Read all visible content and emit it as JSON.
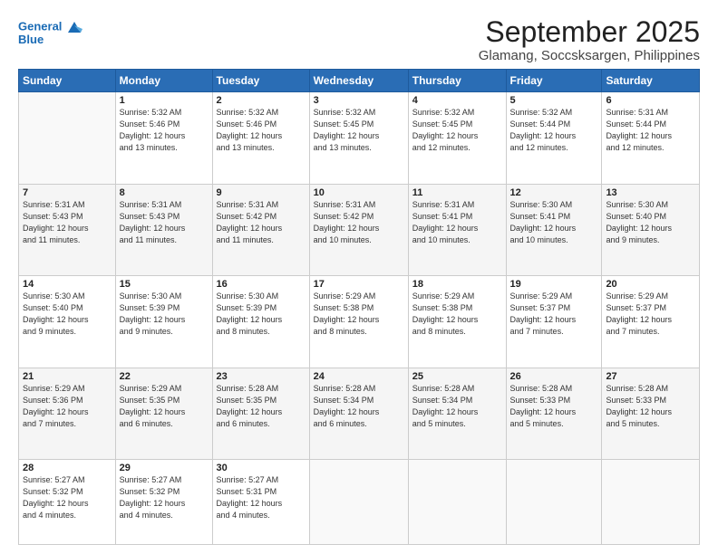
{
  "logo": {
    "line1": "General",
    "line2": "Blue",
    "alt": "GeneralBlue logo"
  },
  "title": "September 2025",
  "subtitle": "Glamang, Soccsksargen, Philippines",
  "days_header": [
    "Sunday",
    "Monday",
    "Tuesday",
    "Wednesday",
    "Thursday",
    "Friday",
    "Saturday"
  ],
  "weeks": [
    [
      {
        "num": "",
        "info": ""
      },
      {
        "num": "1",
        "info": "Sunrise: 5:32 AM\nSunset: 5:46 PM\nDaylight: 12 hours\nand 13 minutes."
      },
      {
        "num": "2",
        "info": "Sunrise: 5:32 AM\nSunset: 5:46 PM\nDaylight: 12 hours\nand 13 minutes."
      },
      {
        "num": "3",
        "info": "Sunrise: 5:32 AM\nSunset: 5:45 PM\nDaylight: 12 hours\nand 13 minutes."
      },
      {
        "num": "4",
        "info": "Sunrise: 5:32 AM\nSunset: 5:45 PM\nDaylight: 12 hours\nand 12 minutes."
      },
      {
        "num": "5",
        "info": "Sunrise: 5:32 AM\nSunset: 5:44 PM\nDaylight: 12 hours\nand 12 minutes."
      },
      {
        "num": "6",
        "info": "Sunrise: 5:31 AM\nSunset: 5:44 PM\nDaylight: 12 hours\nand 12 minutes."
      }
    ],
    [
      {
        "num": "7",
        "info": "Sunrise: 5:31 AM\nSunset: 5:43 PM\nDaylight: 12 hours\nand 11 minutes."
      },
      {
        "num": "8",
        "info": "Sunrise: 5:31 AM\nSunset: 5:43 PM\nDaylight: 12 hours\nand 11 minutes."
      },
      {
        "num": "9",
        "info": "Sunrise: 5:31 AM\nSunset: 5:42 PM\nDaylight: 12 hours\nand 11 minutes."
      },
      {
        "num": "10",
        "info": "Sunrise: 5:31 AM\nSunset: 5:42 PM\nDaylight: 12 hours\nand 10 minutes."
      },
      {
        "num": "11",
        "info": "Sunrise: 5:31 AM\nSunset: 5:41 PM\nDaylight: 12 hours\nand 10 minutes."
      },
      {
        "num": "12",
        "info": "Sunrise: 5:30 AM\nSunset: 5:41 PM\nDaylight: 12 hours\nand 10 minutes."
      },
      {
        "num": "13",
        "info": "Sunrise: 5:30 AM\nSunset: 5:40 PM\nDaylight: 12 hours\nand 9 minutes."
      }
    ],
    [
      {
        "num": "14",
        "info": "Sunrise: 5:30 AM\nSunset: 5:40 PM\nDaylight: 12 hours\nand 9 minutes."
      },
      {
        "num": "15",
        "info": "Sunrise: 5:30 AM\nSunset: 5:39 PM\nDaylight: 12 hours\nand 9 minutes."
      },
      {
        "num": "16",
        "info": "Sunrise: 5:30 AM\nSunset: 5:39 PM\nDaylight: 12 hours\nand 8 minutes."
      },
      {
        "num": "17",
        "info": "Sunrise: 5:29 AM\nSunset: 5:38 PM\nDaylight: 12 hours\nand 8 minutes."
      },
      {
        "num": "18",
        "info": "Sunrise: 5:29 AM\nSunset: 5:38 PM\nDaylight: 12 hours\nand 8 minutes."
      },
      {
        "num": "19",
        "info": "Sunrise: 5:29 AM\nSunset: 5:37 PM\nDaylight: 12 hours\nand 7 minutes."
      },
      {
        "num": "20",
        "info": "Sunrise: 5:29 AM\nSunset: 5:37 PM\nDaylight: 12 hours\nand 7 minutes."
      }
    ],
    [
      {
        "num": "21",
        "info": "Sunrise: 5:29 AM\nSunset: 5:36 PM\nDaylight: 12 hours\nand 7 minutes."
      },
      {
        "num": "22",
        "info": "Sunrise: 5:29 AM\nSunset: 5:35 PM\nDaylight: 12 hours\nand 6 minutes."
      },
      {
        "num": "23",
        "info": "Sunrise: 5:28 AM\nSunset: 5:35 PM\nDaylight: 12 hours\nand 6 minutes."
      },
      {
        "num": "24",
        "info": "Sunrise: 5:28 AM\nSunset: 5:34 PM\nDaylight: 12 hours\nand 6 minutes."
      },
      {
        "num": "25",
        "info": "Sunrise: 5:28 AM\nSunset: 5:34 PM\nDaylight: 12 hours\nand 5 minutes."
      },
      {
        "num": "26",
        "info": "Sunrise: 5:28 AM\nSunset: 5:33 PM\nDaylight: 12 hours\nand 5 minutes."
      },
      {
        "num": "27",
        "info": "Sunrise: 5:28 AM\nSunset: 5:33 PM\nDaylight: 12 hours\nand 5 minutes."
      }
    ],
    [
      {
        "num": "28",
        "info": "Sunrise: 5:27 AM\nSunset: 5:32 PM\nDaylight: 12 hours\nand 4 minutes."
      },
      {
        "num": "29",
        "info": "Sunrise: 5:27 AM\nSunset: 5:32 PM\nDaylight: 12 hours\nand 4 minutes."
      },
      {
        "num": "30",
        "info": "Sunrise: 5:27 AM\nSunset: 5:31 PM\nDaylight: 12 hours\nand 4 minutes."
      },
      {
        "num": "",
        "info": ""
      },
      {
        "num": "",
        "info": ""
      },
      {
        "num": "",
        "info": ""
      },
      {
        "num": "",
        "info": ""
      }
    ]
  ]
}
